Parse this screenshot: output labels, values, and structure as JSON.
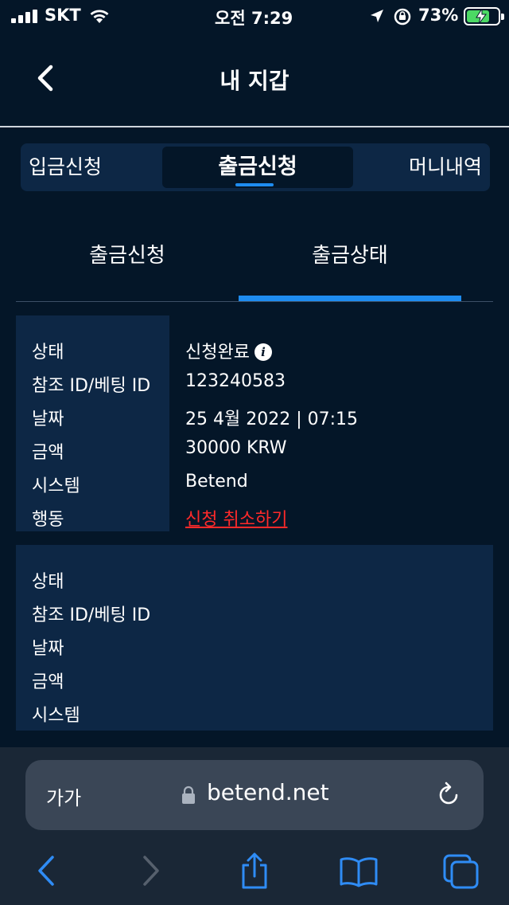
{
  "status_bar": {
    "carrier": "SKT",
    "time": "오전 7:29",
    "battery_percent": "73%",
    "battery_level": 0.73
  },
  "header": {
    "title": "내 지갑"
  },
  "top_tabs": {
    "deposit": "입금신청",
    "withdraw": "출금신청",
    "money_history": "머니내역"
  },
  "sub_tabs": {
    "request": "출금신청",
    "status": "출금상태"
  },
  "record_1": {
    "labels": {
      "status": "상태",
      "ref_id": "참조 ID/베팅 ID",
      "date": "날짜",
      "amount": "금액",
      "system": "시스템",
      "action": "행동"
    },
    "values": {
      "status": "신청완료",
      "ref_id": "123240583",
      "date": "25 4월 2022 | 07:15",
      "amount": "30000 KRW",
      "system": "Betend",
      "action": "신청 취소하기"
    }
  },
  "record_2": {
    "labels": {
      "status": "상태",
      "ref_id": "참조 ID/베팅 ID",
      "date": "날짜",
      "amount": "금액",
      "system": "시스템"
    }
  },
  "browser": {
    "text_size": "가가",
    "url": "betend.net"
  },
  "colors": {
    "background": "#041628",
    "panel": "#0d2745",
    "accent": "#1e8cf0",
    "danger": "#ff2a2a"
  }
}
